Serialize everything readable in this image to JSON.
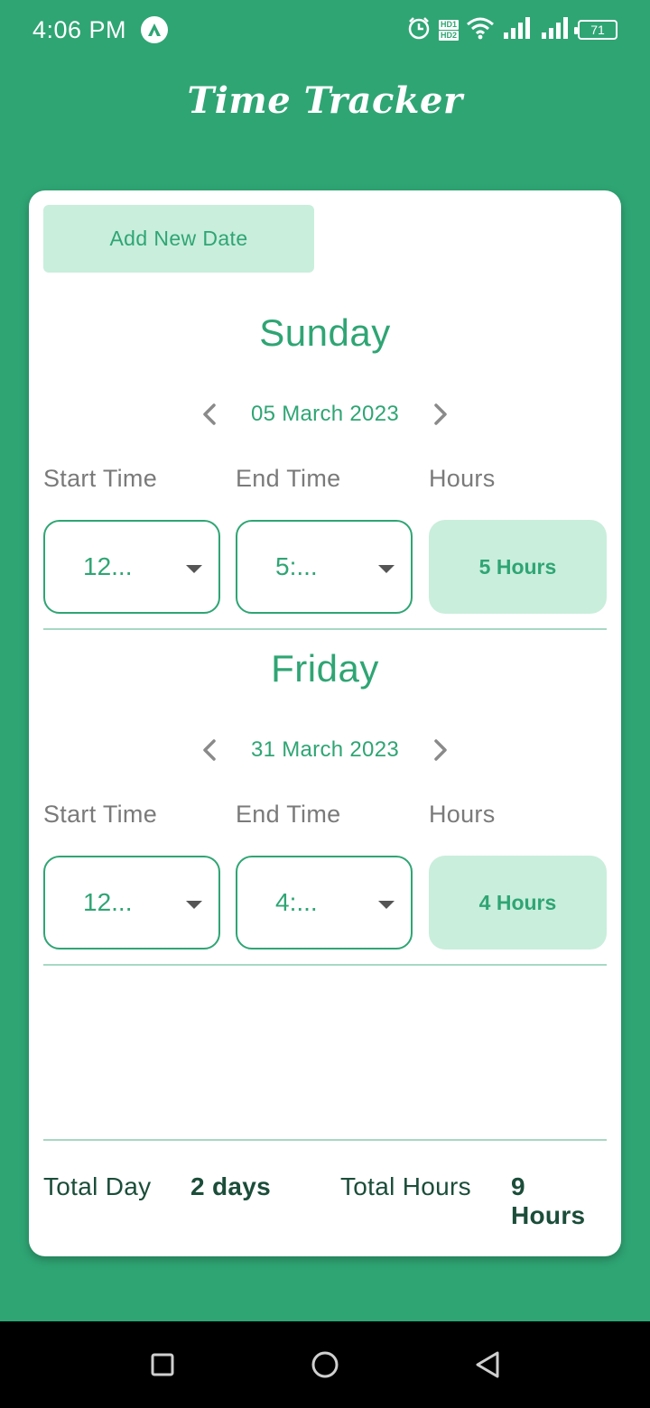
{
  "status_bar": {
    "time": "4:06 PM",
    "hd1": "HD1",
    "hd2": "HD2",
    "battery": "71"
  },
  "app": {
    "title": "Time Tracker"
  },
  "actions": {
    "add_new_date": "Add New Date"
  },
  "entries": [
    {
      "day": "Sunday",
      "date": "05 March 2023",
      "labels": {
        "start": "Start Time",
        "end": "End Time",
        "hours": "Hours"
      },
      "start_value": "12...",
      "end_value": "5:...",
      "hours_value": "5 Hours"
    },
    {
      "day": "Friday",
      "date": "31 March 2023",
      "labels": {
        "start": "Start Time",
        "end": "End Time",
        "hours": "Hours"
      },
      "start_value": "12...",
      "end_value": "4:...",
      "hours_value": "4 Hours"
    }
  ],
  "totals": {
    "total_day_label": "Total Day",
    "total_day_value": "2 days",
    "total_hours_label": "Total Hours",
    "total_hours_value": "9 Hours"
  },
  "colors": {
    "primary": "#2fa574",
    "accent_light": "#c9eedc",
    "nav_bar": "#000000"
  },
  "icons": {
    "alarm": "alarm-icon",
    "wifi": "wifi-icon",
    "signal": "signal-icon",
    "battery": "battery-icon",
    "prev": "chevron-left-icon",
    "next": "chevron-right-icon",
    "dropdown": "caret-down-icon",
    "nav_recent": "square-icon",
    "nav_home": "circle-icon",
    "nav_back": "triangle-back-icon"
  }
}
